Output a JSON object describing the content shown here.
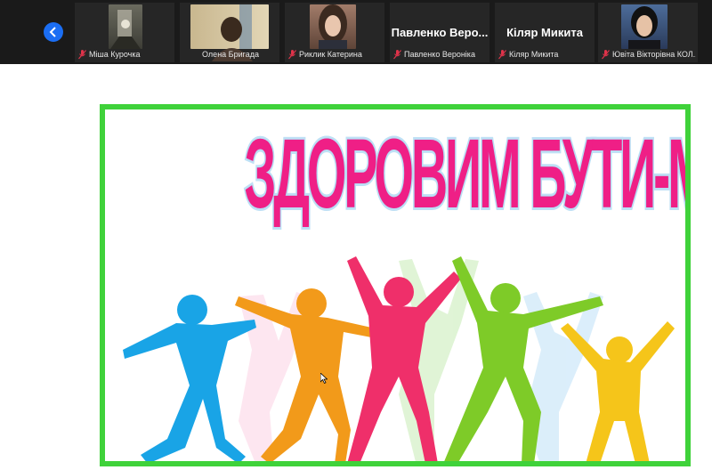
{
  "participants": [
    {
      "name": "Міша Курочка",
      "has_video": true,
      "muted": true
    },
    {
      "name": "Олена Бригада",
      "has_video": true,
      "muted": false
    },
    {
      "name": "Риклик Катерина",
      "has_video": true,
      "muted": true
    },
    {
      "name": "Павленко Вероніка",
      "display_name": "Павленко  Веро...",
      "has_video": false,
      "muted": true
    },
    {
      "name": "Кіляр Микита",
      "display_name": "Кіляр Микита",
      "has_video": false,
      "muted": true
    },
    {
      "name": "Ювіта Вікторівна КОЛ...",
      "has_video": true,
      "muted": true
    }
  ],
  "slide": {
    "title": "ЗДОРОВИМ  БУТИ-МОДНО",
    "colors": {
      "title": "#ef1f86",
      "border": "#3fd23a"
    }
  },
  "colors": {
    "topbar": "#1a1a1a",
    "nav_button": "#1b6ef3",
    "mic_muted": "#e0334a"
  }
}
